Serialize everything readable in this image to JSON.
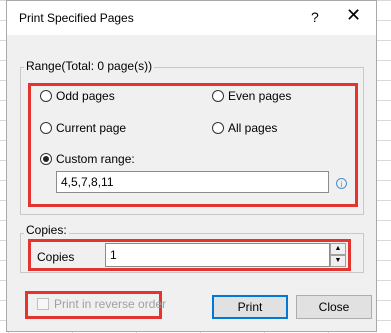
{
  "dialog": {
    "title": "Print Specified Pages",
    "help_label": "?",
    "close_label": "✕"
  },
  "range": {
    "legend": "Range(Total: 0 page(s))",
    "options": {
      "odd": "Odd pages",
      "even": "Even pages",
      "current": "Current page",
      "all": "All pages",
      "custom": "Custom range:"
    },
    "selected": "custom",
    "custom_value": "4,5,7,8,11",
    "info_glyph": "i"
  },
  "copies": {
    "legend": "Copies:",
    "label": "Copies",
    "value": "1",
    "up_glyph": "▲",
    "down_glyph": "▼"
  },
  "reverse": {
    "label": "Print in reverse order",
    "checked": false
  },
  "buttons": {
    "print": "Print",
    "close": "Close"
  },
  "colors": {
    "highlight": "#e3342f",
    "dialog_bg": "#f0f0f0",
    "primary_border": "#0078d7"
  }
}
